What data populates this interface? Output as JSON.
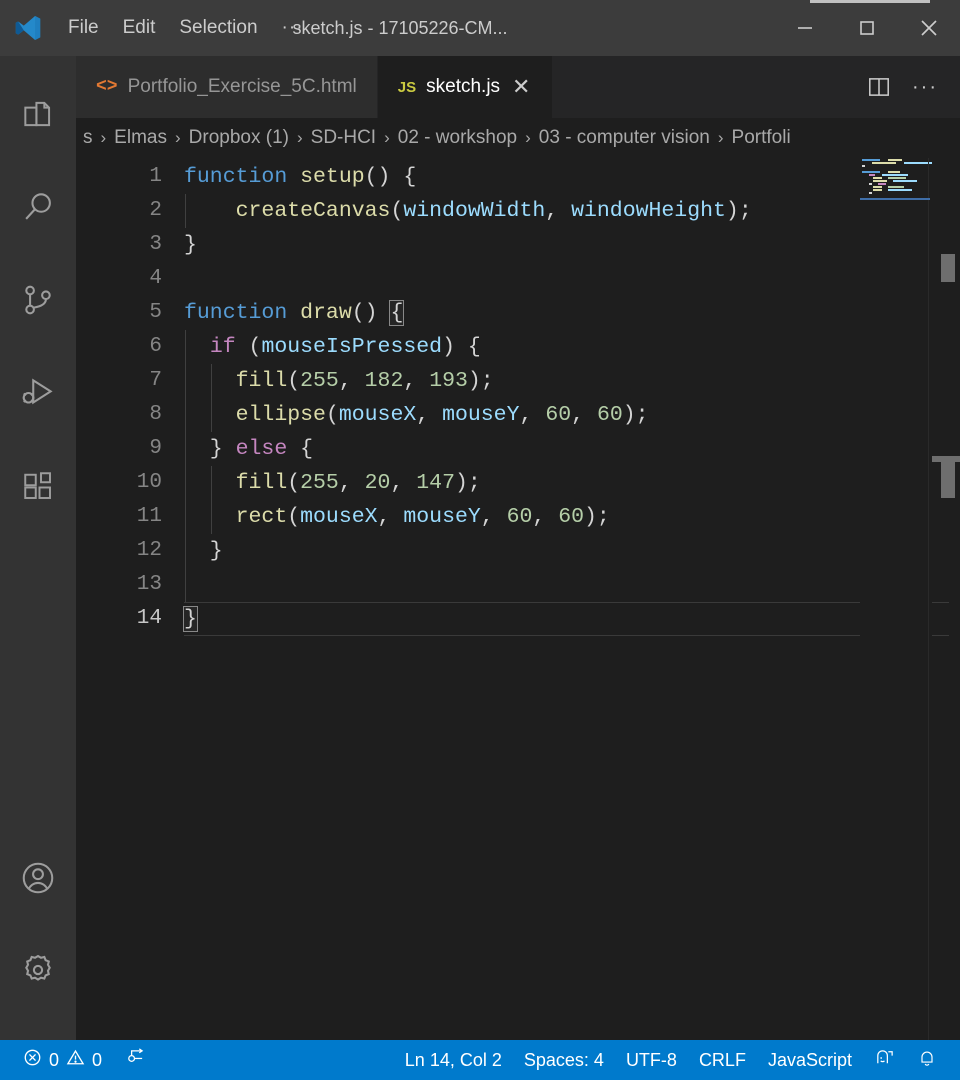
{
  "titlebar": {
    "logo_icon": "vscode-logo-icon",
    "menu": [
      {
        "label": "File",
        "name": "menu-file"
      },
      {
        "label": "Edit",
        "name": "menu-edit"
      },
      {
        "label": "Selection",
        "name": "menu-selection"
      }
    ],
    "menu_overflow": "···",
    "window_title": "sketch.js - 17105226-CM...",
    "controls": {
      "minimize_icon": "minimize-icon",
      "maximize_icon": "maximize-icon",
      "close_icon": "close-icon"
    }
  },
  "activitybar": {
    "top_items": [
      {
        "name": "activity-explorer",
        "icon": "files-icon",
        "label": "Explorer"
      },
      {
        "name": "activity-search",
        "icon": "search-icon",
        "label": "Search"
      },
      {
        "name": "activity-source-control",
        "icon": "source-control-icon",
        "label": "Source Control"
      },
      {
        "name": "activity-run-debug",
        "icon": "run-and-debug-icon",
        "label": "Run and Debug"
      },
      {
        "name": "activity-extensions",
        "icon": "extensions-icon",
        "label": "Extensions"
      }
    ],
    "bottom_items": [
      {
        "name": "activity-accounts",
        "icon": "account-icon",
        "label": "Accounts"
      },
      {
        "name": "activity-settings",
        "icon": "gear-icon",
        "label": "Manage"
      }
    ]
  },
  "tabs": [
    {
      "label": "Portfolio_Exercise_5C.html",
      "icon": "html-file-icon",
      "icon_text": "<>",
      "active": false
    },
    {
      "label": "sketch.js",
      "icon": "js-file-icon",
      "icon_text": "JS",
      "active": true
    }
  ],
  "tab_close_glyph": "✕",
  "tab_actions": {
    "split_editor_icon": "split-editor-icon",
    "more_actions_label": "···"
  },
  "breadcrumb": {
    "leading_fragment": "s",
    "items": [
      "Elmas",
      "Dropbox (1)",
      "SD-HCI",
      "02 - workshop",
      "03 - computer vision",
      "Portfoli"
    ],
    "separator": "›"
  },
  "editor": {
    "line_numbers": [
      "1",
      "2",
      "3",
      "4",
      "5",
      "6",
      "7",
      "8",
      "9",
      "10",
      "11",
      "12",
      "13",
      "14"
    ],
    "current_line": 14,
    "code_lines": [
      [
        {
          "t": "function",
          "c": "kw"
        },
        {
          "t": " ",
          "c": "pl"
        },
        {
          "t": "setup",
          "c": "fn"
        },
        {
          "t": "() {",
          "c": "pl"
        }
      ],
      [
        {
          "t": "    ",
          "c": "pl"
        },
        {
          "t": "createCanvas",
          "c": "fn"
        },
        {
          "t": "(",
          "c": "pl"
        },
        {
          "t": "windowWidth",
          "c": "var"
        },
        {
          "t": ", ",
          "c": "pl"
        },
        {
          "t": "windowHeight",
          "c": "var"
        },
        {
          "t": ");",
          "c": "pl"
        }
      ],
      [
        {
          "t": "}",
          "c": "pl"
        }
      ],
      [],
      [
        {
          "t": "function",
          "c": "kw"
        },
        {
          "t": " ",
          "c": "pl"
        },
        {
          "t": "draw",
          "c": "fn"
        },
        {
          "t": "() ",
          "c": "pl"
        },
        {
          "t": "{",
          "c": "pl",
          "match": true
        }
      ],
      [
        {
          "t": "  ",
          "c": "pl"
        },
        {
          "t": "if",
          "c": "ctl"
        },
        {
          "t": " (",
          "c": "pl"
        },
        {
          "t": "mouseIsPressed",
          "c": "var"
        },
        {
          "t": ") {",
          "c": "pl"
        }
      ],
      [
        {
          "t": "    ",
          "c": "pl"
        },
        {
          "t": "fill",
          "c": "fn"
        },
        {
          "t": "(",
          "c": "pl"
        },
        {
          "t": "255",
          "c": "num"
        },
        {
          "t": ", ",
          "c": "pl"
        },
        {
          "t": "182",
          "c": "num"
        },
        {
          "t": ", ",
          "c": "pl"
        },
        {
          "t": "193",
          "c": "num"
        },
        {
          "t": ");",
          "c": "pl"
        }
      ],
      [
        {
          "t": "    ",
          "c": "pl"
        },
        {
          "t": "ellipse",
          "c": "fn"
        },
        {
          "t": "(",
          "c": "pl"
        },
        {
          "t": "mouseX",
          "c": "var"
        },
        {
          "t": ", ",
          "c": "pl"
        },
        {
          "t": "mouseY",
          "c": "var"
        },
        {
          "t": ", ",
          "c": "pl"
        },
        {
          "t": "60",
          "c": "num"
        },
        {
          "t": ", ",
          "c": "pl"
        },
        {
          "t": "60",
          "c": "num"
        },
        {
          "t": ");",
          "c": "pl"
        }
      ],
      [
        {
          "t": "  } ",
          "c": "pl"
        },
        {
          "t": "else",
          "c": "ctl"
        },
        {
          "t": " {",
          "c": "pl"
        }
      ],
      [
        {
          "t": "    ",
          "c": "pl"
        },
        {
          "t": "fill",
          "c": "fn"
        },
        {
          "t": "(",
          "c": "pl"
        },
        {
          "t": "255",
          "c": "num"
        },
        {
          "t": ", ",
          "c": "pl"
        },
        {
          "t": "20",
          "c": "num"
        },
        {
          "t": ", ",
          "c": "pl"
        },
        {
          "t": "147",
          "c": "num"
        },
        {
          "t": ");",
          "c": "pl"
        }
      ],
      [
        {
          "t": "    ",
          "c": "pl"
        },
        {
          "t": "rect",
          "c": "fn"
        },
        {
          "t": "(",
          "c": "pl"
        },
        {
          "t": "mouseX",
          "c": "var"
        },
        {
          "t": ", ",
          "c": "pl"
        },
        {
          "t": "mouseY",
          "c": "var"
        },
        {
          "t": ", ",
          "c": "pl"
        },
        {
          "t": "60",
          "c": "num"
        },
        {
          "t": ", ",
          "c": "pl"
        },
        {
          "t": "60",
          "c": "num"
        },
        {
          "t": ");",
          "c": "pl"
        }
      ],
      [
        {
          "t": "  }",
          "c": "pl"
        }
      ],
      [],
      [
        {
          "t": "}",
          "c": "pl",
          "match": true
        }
      ]
    ],
    "full_text": "function setup() {\n    createCanvas(windowWidth, windowHeight);\n}\n\nfunction draw() {\n  if (mouseIsPressed) {\n    fill(255, 182, 193);\n    ellipse(mouseX, mouseY, 60, 60);\n  } else {\n    fill(255, 20, 147);\n    rect(mouseX, mouseY, 60, 60);\n  }\n\n}"
  },
  "statusbar": {
    "errors_icon": "error-icon",
    "errors_count": "0",
    "warnings_icon": "warning-icon",
    "warnings_count": "0",
    "ports_icon": "remote-ports-icon",
    "right_items": [
      {
        "name": "status-cursor-position",
        "label": "Ln 14, Col 2"
      },
      {
        "name": "status-indentation",
        "label": "Spaces: 4"
      },
      {
        "name": "status-encoding",
        "label": "UTF-8"
      },
      {
        "name": "status-eol",
        "label": "CRLF"
      },
      {
        "name": "status-language-mode",
        "label": "JavaScript"
      }
    ],
    "feedback_icon": "feedback-smiley-icon",
    "notifications_icon": "bell-icon"
  },
  "colors": {
    "accent": "#007acc",
    "titlebar_bg": "#3c3c3c",
    "activitybar_bg": "#333333",
    "editor_bg": "#1e1e1e",
    "tabbar_bg": "#252526",
    "tab_inactive_bg": "#2d2d2d",
    "keyword": "#569cd6",
    "control": "#c586c0",
    "function": "#dcdcaa",
    "variable": "#9cdcfe",
    "number": "#b5cea8",
    "plain": "#d4d4d4",
    "html_icon": "#e37933",
    "js_icon": "#cbcb41"
  }
}
